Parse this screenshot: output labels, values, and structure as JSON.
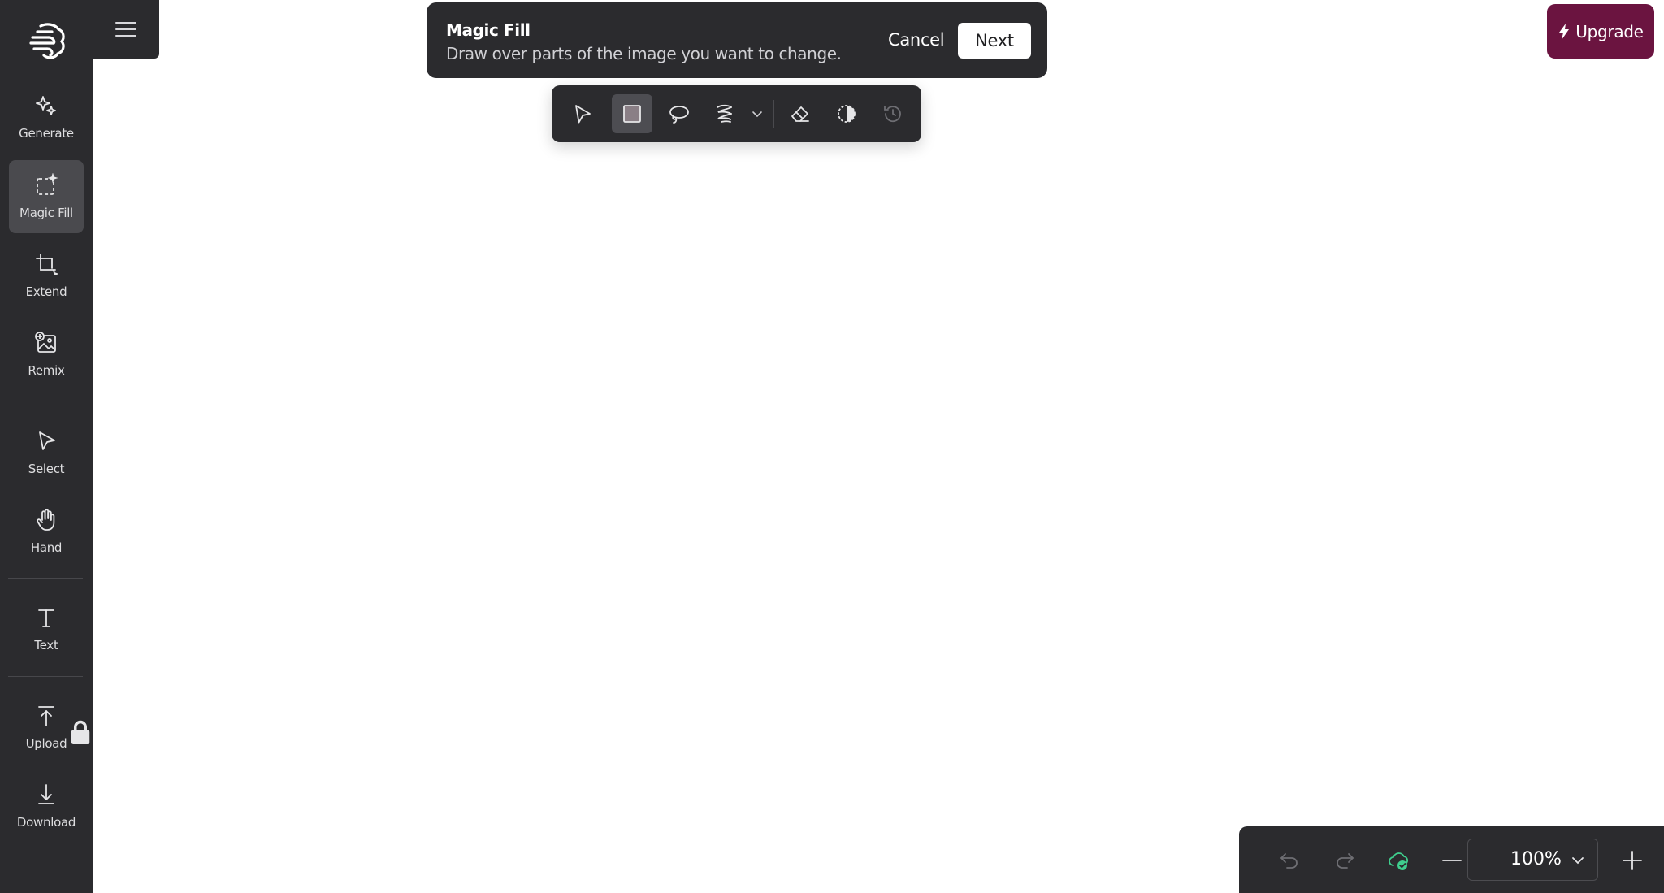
{
  "sidebar": {
    "logo_icon": "brain-logo-icon",
    "items": [
      {
        "label": "Generate",
        "icon": "sparkle-icon"
      },
      {
        "label": "Magic Fill",
        "icon": "magic-fill-icon",
        "active": true
      },
      {
        "label": "Extend",
        "icon": "crop-extend-icon"
      },
      {
        "label": "Remix",
        "icon": "image-plus-icon"
      },
      {
        "label": "Select",
        "icon": "cursor-icon"
      },
      {
        "label": "Hand",
        "icon": "hand-icon"
      },
      {
        "label": "Text",
        "icon": "text-icon"
      },
      {
        "label": "Upload",
        "icon": "upload-icon",
        "locked": true
      },
      {
        "label": "Download",
        "icon": "download-icon"
      }
    ]
  },
  "header": {
    "menu_icon": "hamburger-icon"
  },
  "banner": {
    "title": "Magic Fill",
    "subtitle": "Draw over parts of the image you want to change.",
    "cancel_label": "Cancel",
    "next_label": "Next"
  },
  "toolbar": {
    "tools": [
      {
        "icon": "cursor-icon"
      },
      {
        "icon": "rectangle-select-icon",
        "active": true
      },
      {
        "icon": "lasso-icon"
      },
      {
        "icon": "brush-icon"
      },
      {
        "icon": "chevron-down-icon"
      },
      {
        "icon": "eraser-icon"
      },
      {
        "icon": "invert-icon"
      },
      {
        "icon": "history-icon",
        "disabled": true
      }
    ]
  },
  "upgrade": {
    "label": "Upgrade",
    "color": "#6b1440"
  },
  "bottom_bar": {
    "zoom": "100%"
  },
  "colors": {
    "panel": "#2b2b2e",
    "accent": "#6b1440",
    "cloud_ok": "#3fcf8e"
  }
}
